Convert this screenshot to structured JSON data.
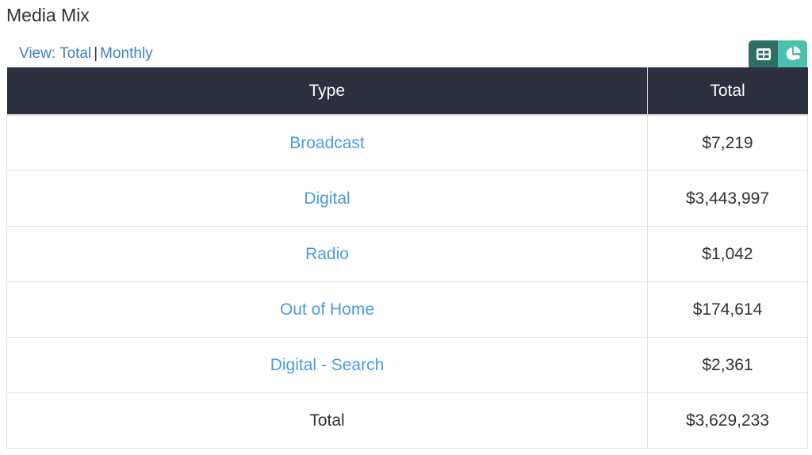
{
  "widget": {
    "title": "Media Mix",
    "view_prefix": "View: ",
    "view_options": [
      "Total",
      "Monthly"
    ],
    "view_separator": "|",
    "toggle": {
      "table_icon": "table-grid-icon",
      "pie_icon": "pie-chart-icon",
      "active": "table",
      "colors": {
        "active": "#2f6e63",
        "inactive": "#4dbfae"
      }
    }
  },
  "table": {
    "headers": [
      "Type",
      "Total"
    ],
    "rows": [
      {
        "type": "Broadcast",
        "total": "$7,219"
      },
      {
        "type": "Digital",
        "total": "$3,443,997"
      },
      {
        "type": "Radio",
        "total": "$1,042"
      },
      {
        "type": "Out of Home",
        "total": "$174,614"
      },
      {
        "type": "Digital - Search",
        "total": "$2,361"
      }
    ],
    "total_row": {
      "label": "Total",
      "total": "$3,629,233"
    }
  },
  "colors": {
    "header_bg": "#2c2f3e",
    "link": "#4a9be0",
    "view_link": "#3d84c0"
  }
}
